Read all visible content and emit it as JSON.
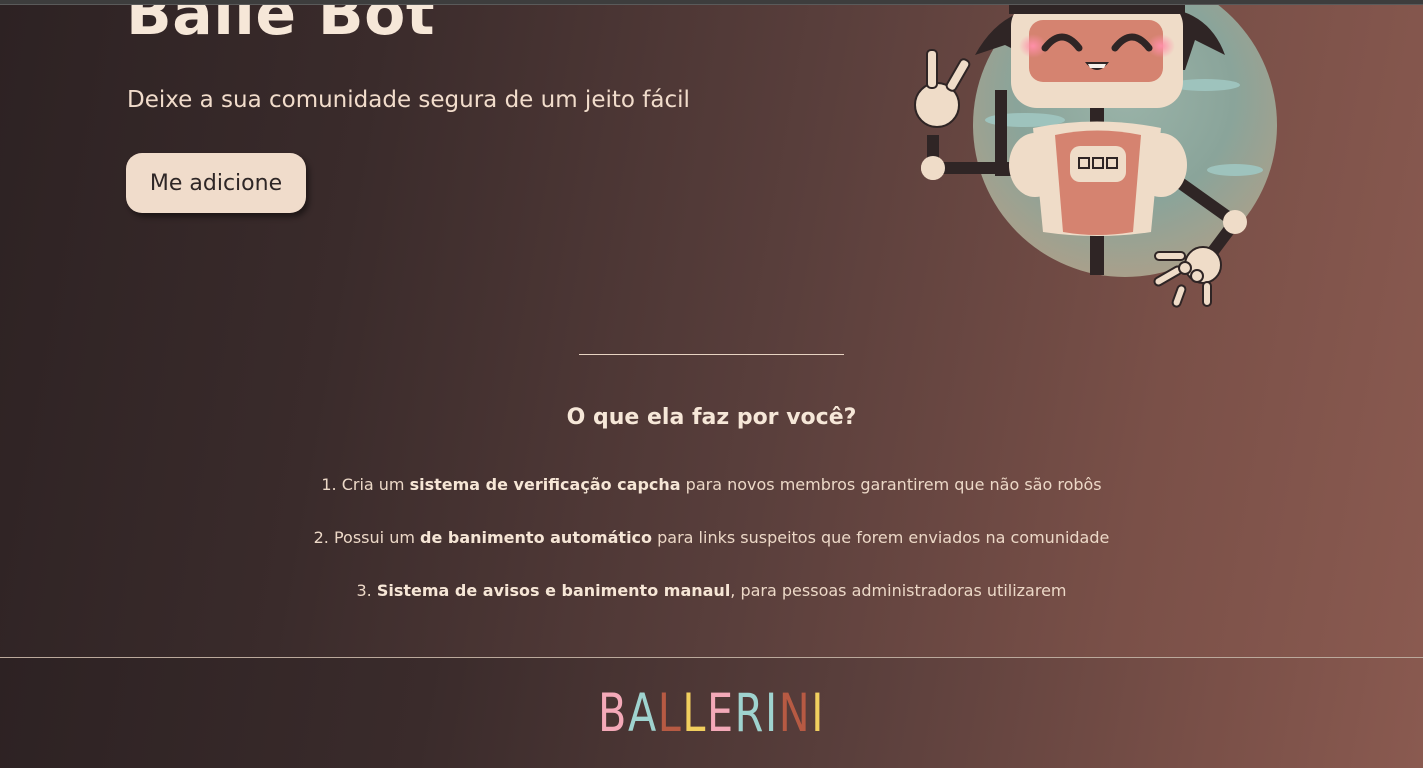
{
  "hero": {
    "title": "Balle Bot",
    "subtitle": "Deixe a sua comunidade segura de um jeito fácil",
    "add_button_label": "Me adicione"
  },
  "features": {
    "title": "O que ela faz por você?",
    "items": [
      {
        "prefix": "1. Cria um ",
        "bold": "sistema de verificação capcha",
        "suffix": " para novos membros garantirem que não são robôs"
      },
      {
        "prefix": "2. Possui um ",
        "bold": "de banimento automático",
        "suffix": " para links suspeitos que forem enviados na comunidade"
      },
      {
        "prefix": "3. ",
        "bold": "Sistema de avisos e banimento manaul",
        "suffix": ", para pessoas administradoras utilizarem"
      }
    ]
  },
  "footer": {
    "logo_letters": [
      {
        "char": "B",
        "color": "#f4a9b8"
      },
      {
        "char": "A",
        "color": "#9fd3cf"
      },
      {
        "char": "L",
        "color": "#b75a43"
      },
      {
        "char": "L",
        "color": "#f1cf5e"
      },
      {
        "char": "E",
        "color": "#f4a9b8"
      },
      {
        "char": "R",
        "color": "#9fd3cf"
      },
      {
        "char": "I",
        "color": "#9fd3cf"
      },
      {
        "char": "N",
        "color": "#b75a43"
      },
      {
        "char": "I",
        "color": "#f1cf5e"
      }
    ]
  },
  "colors": {
    "text_light": "#f1dccb",
    "button_bg": "#f0dccb",
    "robot_skin": "#efdcc8",
    "robot_face": "#d58370",
    "robot_dark": "#2f2525",
    "sky_circle": "#8faaa1"
  },
  "icons": {
    "robot": "robot-illustration"
  }
}
